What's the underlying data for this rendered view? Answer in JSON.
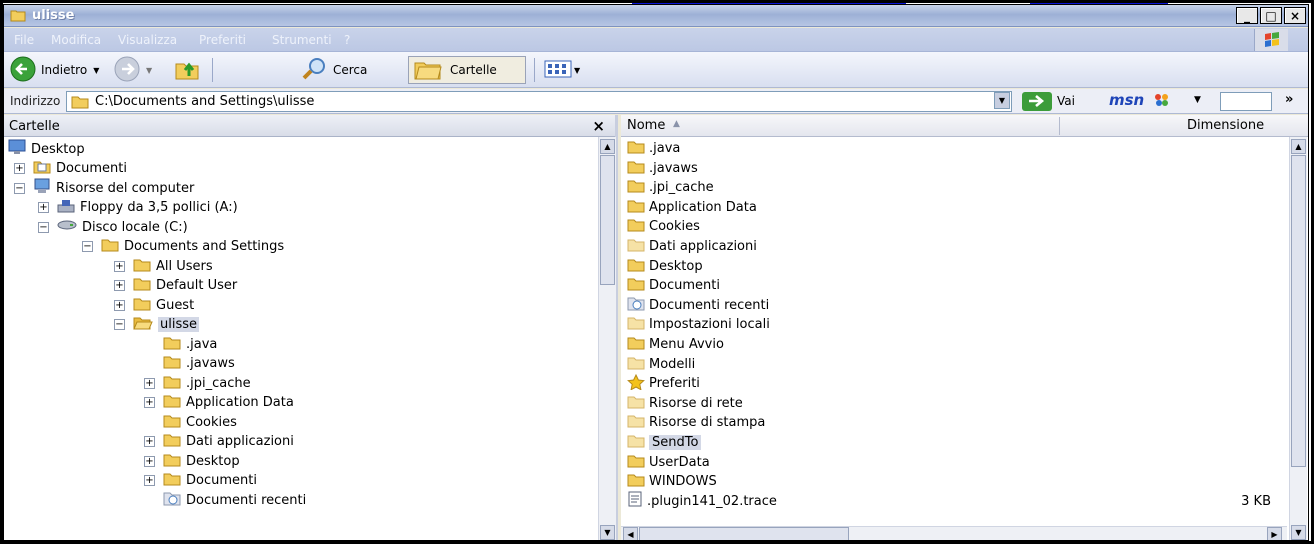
{
  "window": {
    "title": "ulisse"
  },
  "window_controls": [
    "_",
    "□",
    "×"
  ],
  "menu": [
    "File",
    "Modifica",
    "Visualizza",
    "Preferiti",
    "Strumenti",
    "?"
  ],
  "toolbar": {
    "back_label": "Indietro",
    "search_label": "Cerca",
    "folders_label": "Cartelle"
  },
  "address": {
    "label": "Indirizzo",
    "value": "C:\\Documents and Settings\\ulisse",
    "go_label": "Vai",
    "msn_label": "msn",
    "more": "»"
  },
  "folders_pane": {
    "title": "Cartelle",
    "close": "×",
    "tree": [
      {
        "label": "Desktop",
        "level": 0,
        "expander": "",
        "icon": "desktop-icon"
      },
      {
        "label": "Documenti",
        "level": 1,
        "expander": "+",
        "icon": "documents-folder-icon"
      },
      {
        "label": "Risorse del computer",
        "level": 1,
        "expander": "−",
        "icon": "my-computer-icon"
      },
      {
        "label": "Floppy da 3,5 pollici (A:)",
        "level": 2,
        "expander": "+",
        "icon": "floppy-drive-icon"
      },
      {
        "label": "Disco locale (C:)",
        "level": 2,
        "expander": "−",
        "icon": "hard-drive-icon"
      },
      {
        "label": "Documents and Settings",
        "level": 3,
        "expander": "−",
        "icon": "folder-icon"
      },
      {
        "label": "All Users",
        "level": 4,
        "expander": "+",
        "icon": "folder-icon"
      },
      {
        "label": "Default User",
        "level": 4,
        "expander": "+",
        "icon": "folder-icon"
      },
      {
        "label": "Guest",
        "level": 4,
        "expander": "+",
        "icon": "folder-icon"
      },
      {
        "label": "ulisse",
        "level": 4,
        "expander": "−",
        "icon": "open-folder-icon",
        "selected": true
      },
      {
        "label": ".java",
        "level": 5,
        "expander": "",
        "icon": "folder-icon"
      },
      {
        "label": ".javaws",
        "level": 5,
        "expander": "",
        "icon": "folder-icon"
      },
      {
        "label": ".jpi_cache",
        "level": 5,
        "expander": "+",
        "icon": "folder-icon"
      },
      {
        "label": "Application Data",
        "level": 5,
        "expander": "+",
        "icon": "folder-icon"
      },
      {
        "label": "Cookies",
        "level": 5,
        "expander": "",
        "icon": "folder-icon"
      },
      {
        "label": "Dati applicazioni",
        "level": 5,
        "expander": "+",
        "icon": "folder-icon"
      },
      {
        "label": "Desktop",
        "level": 5,
        "expander": "+",
        "icon": "folder-icon"
      },
      {
        "label": "Documenti",
        "level": 5,
        "expander": "+",
        "icon": "folder-icon"
      },
      {
        "label": "Documenti recenti",
        "level": 5,
        "expander": "",
        "icon": "recent-documents-icon"
      }
    ]
  },
  "file_list": {
    "columns": {
      "name": "Nome",
      "size": "Dimensione"
    },
    "items": [
      {
        "name": ".java",
        "icon": "folder-icon",
        "size": ""
      },
      {
        "name": ".javaws",
        "icon": "folder-icon",
        "size": ""
      },
      {
        "name": ".jpi_cache",
        "icon": "folder-icon",
        "size": ""
      },
      {
        "name": "Application Data",
        "icon": "folder-icon",
        "size": ""
      },
      {
        "name": "Cookies",
        "icon": "folder-icon",
        "size": ""
      },
      {
        "name": "Dati applicazioni",
        "icon": "hidden-folder-icon",
        "size": ""
      },
      {
        "name": "Desktop",
        "icon": "folder-icon",
        "size": ""
      },
      {
        "name": "Documenti",
        "icon": "folder-icon",
        "size": ""
      },
      {
        "name": "Documenti recenti",
        "icon": "recent-documents-icon",
        "size": ""
      },
      {
        "name": "Impostazioni locali",
        "icon": "hidden-folder-icon",
        "size": ""
      },
      {
        "name": "Menu Avvio",
        "icon": "folder-icon",
        "size": ""
      },
      {
        "name": "Modelli",
        "icon": "hidden-folder-icon",
        "size": ""
      },
      {
        "name": "Preferiti",
        "icon": "favorites-star-icon",
        "size": ""
      },
      {
        "name": "Risorse di rete",
        "icon": "hidden-folder-icon",
        "size": ""
      },
      {
        "name": "Risorse di stampa",
        "icon": "hidden-folder-icon",
        "size": ""
      },
      {
        "name": "SendTo",
        "icon": "hidden-folder-icon",
        "size": "",
        "selected": true
      },
      {
        "name": "UserData",
        "icon": "folder-icon",
        "size": ""
      },
      {
        "name": "WINDOWS",
        "icon": "folder-icon",
        "size": ""
      },
      {
        "name": ".plugin141_02.trace",
        "icon": "text-file-icon",
        "size": "3 KB"
      }
    ]
  },
  "colors": {
    "selection": "#d3d8e6",
    "folder": "#f2cd5c",
    "folder_faded": "#f6e2a6"
  }
}
